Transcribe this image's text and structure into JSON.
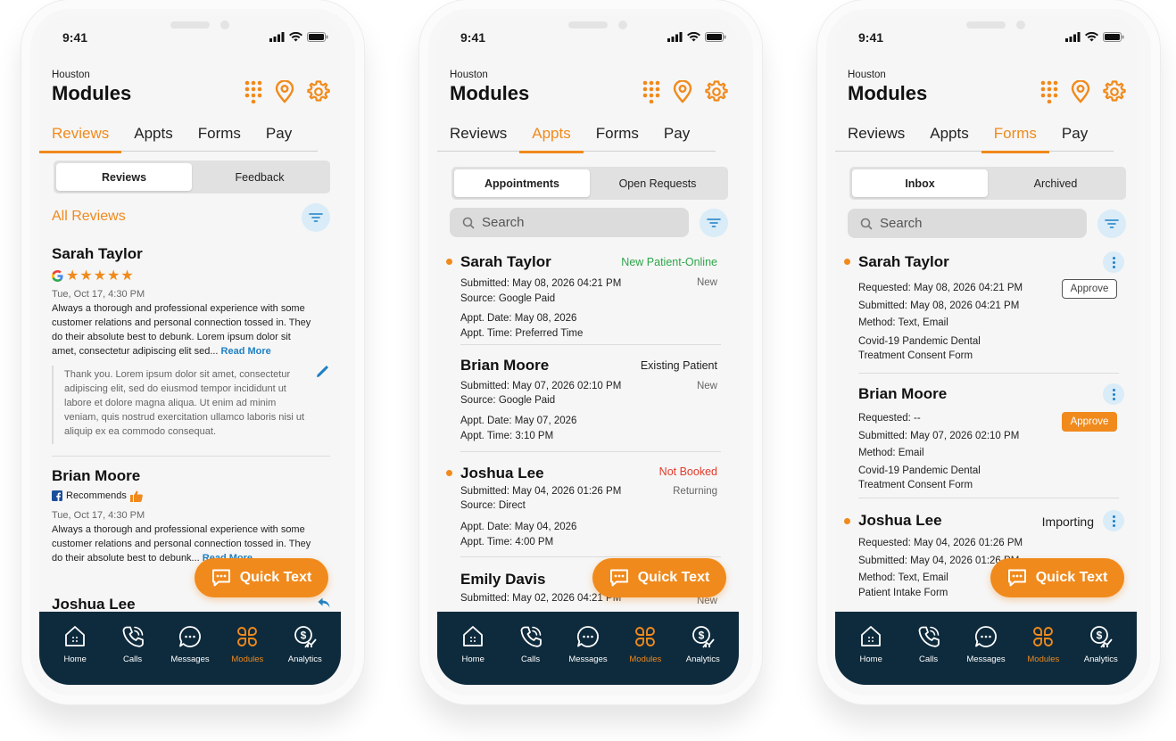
{
  "colors": {
    "accent": "#f08a1c",
    "navbar": "#0e2b3d",
    "link": "#1f80c4",
    "green": "#2ea64a",
    "red": "#e23b2b"
  },
  "status_time": "9:41",
  "header": {
    "location": "Houston",
    "title": "Modules"
  },
  "tabs": [
    "Reviews",
    "Appts",
    "Forms",
    "Pay"
  ],
  "nav": [
    "Home",
    "Calls",
    "Messages",
    "Modules",
    "Analytics"
  ],
  "quick_text": "Quick Text",
  "screen1": {
    "seg": [
      "Reviews",
      "Feedback"
    ],
    "section": "All Reviews",
    "r1": {
      "name": "Sarah Taylor",
      "stars": "★★★★★",
      "date": "Tue, Oct 17, 4:30 PM",
      "body": "Always a thorough and professional experience with some customer relations and personal connection tossed in. They do their absolute best to debunk. Lorem ipsum dolor sit amet, consectetur adipiscing elit sed...",
      "read_more": "Read More",
      "reply": "Thank you. Lorem ipsum dolor sit amet, consectetur adipiscing elit, sed do eiusmod tempor incididunt ut labore et dolore magna aliqua. Ut enim ad minim veniam, quis nostrud exercitation ullamco laboris nisi ut aliquip ex ea commodo consequat."
    },
    "r2": {
      "name": "Brian Moore",
      "recommend": "Recommends",
      "date": "Tue, Oct 17, 4:30 PM",
      "body": "Always a thorough and professional experience with some customer relations and personal connection tossed in. They do their absolute best to debunk...",
      "read_more": "Read More"
    },
    "r3": {
      "name": "Joshua Lee"
    }
  },
  "screen2": {
    "seg": [
      "Appointments",
      "Open Requests"
    ],
    "search": "Search",
    "items": [
      {
        "name": "Sarah Taylor",
        "tag": "New Patient-Online",
        "submitted": "Submitted: May 08, 2026 04:21 PM",
        "status": "New",
        "source": "Source: Google Paid",
        "date": "Appt. Date: May 08, 2026",
        "time": "Appt. Time: Preferred Time"
      },
      {
        "name": "Brian Moore",
        "tag": "Existing Patient",
        "submitted": "Submitted: May 07, 2026 02:10 PM",
        "status": "New",
        "source": "Source: Google Paid",
        "date": "Appt. Date: May 07, 2026",
        "time": "Appt. Time: 3:10 PM"
      },
      {
        "name": "Joshua Lee",
        "tag": "Not Booked",
        "submitted": "Submitted: May 04, 2026 01:26 PM",
        "status": "Returning",
        "source": "Source: Direct",
        "date": "Appt. Date: May 04, 2026",
        "time": "Appt. Time: 4:00 PM"
      },
      {
        "name": "Emily Davis",
        "submitted": "Submitted: May 02, 2026 04:21 PM",
        "status": "New"
      }
    ]
  },
  "screen3": {
    "seg": [
      "Inbox",
      "Archived"
    ],
    "search": "Search",
    "items": [
      {
        "name": "Sarah Taylor",
        "requested": "Requested: May 08, 2026 04:21 PM",
        "submitted": "Submitted: May 08, 2026 04:21 PM",
        "method": "Method: Text, Email",
        "form": "Covid-19 Pandemic Dental Treatment Consent Form",
        "action": "Approve"
      },
      {
        "name": "Brian Moore",
        "requested": "Requested: --",
        "submitted": "Submitted: May 07, 2026 02:10 PM",
        "method": "Method: Email",
        "form": "Covid-19 Pandemic Dental Treatment Consent Form",
        "action": "Approve"
      },
      {
        "name": "Joshua Lee",
        "status": "Importing",
        "requested": "Requested: May 04, 2026 01:26 PM",
        "submitted": "Submitted: May 04, 2026 01:26 PM",
        "method": "Method: Text, Email",
        "form": "Patient Intake Form"
      }
    ]
  }
}
